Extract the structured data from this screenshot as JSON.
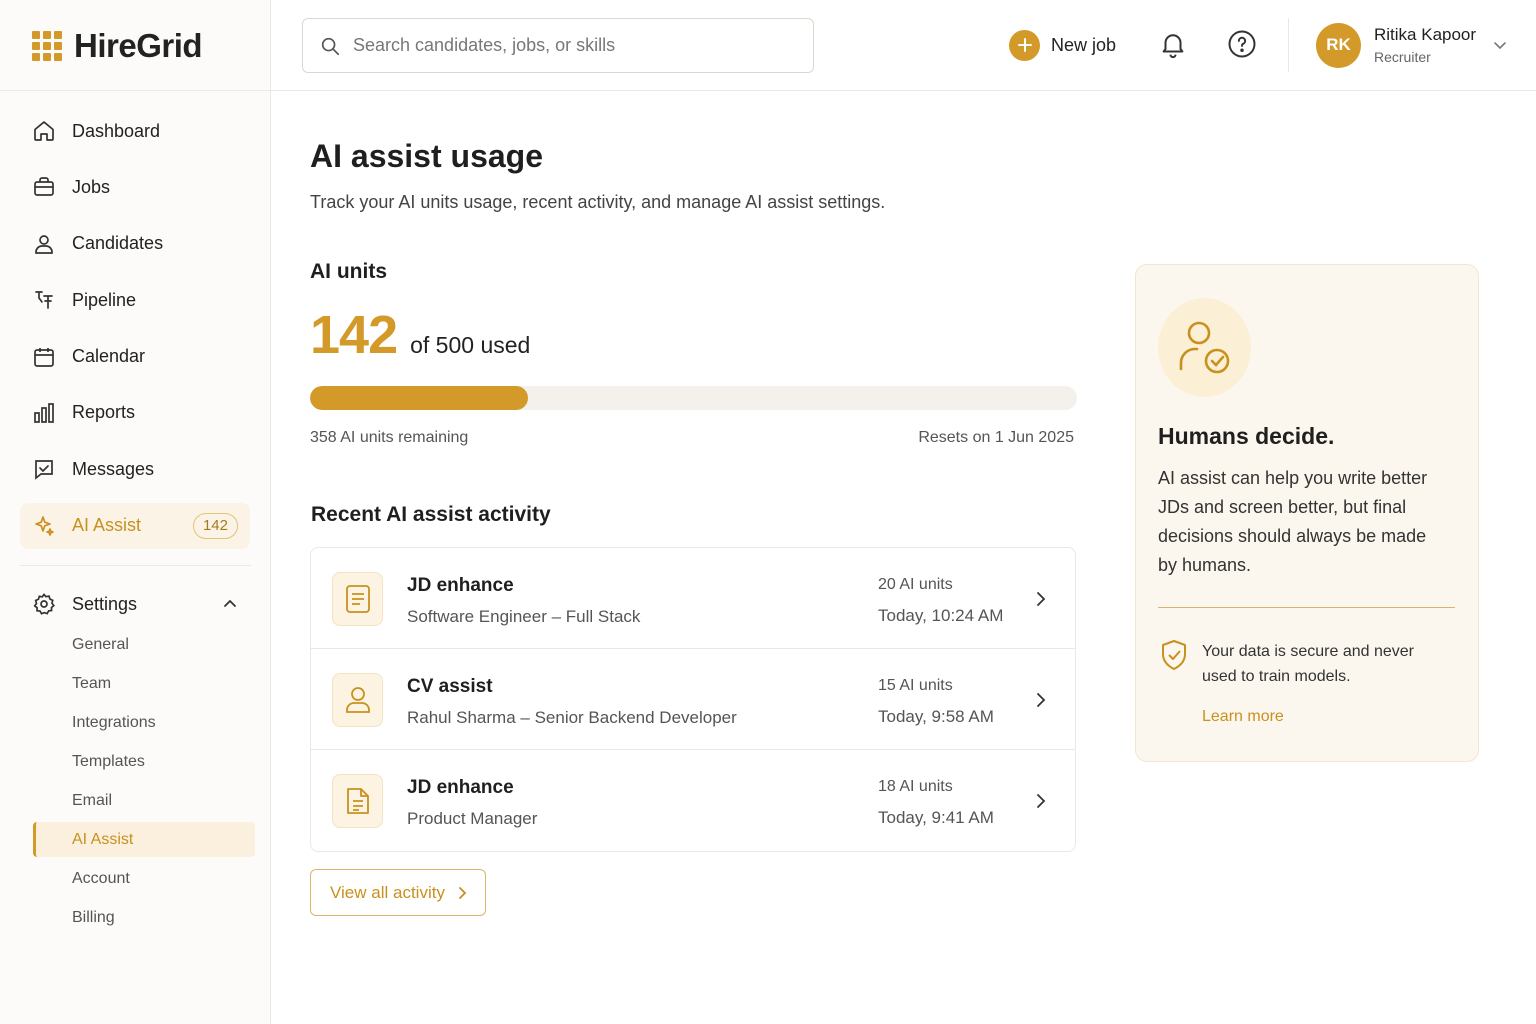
{
  "app": {
    "name": "HireGrid"
  },
  "sidebar": {
    "items": [
      {
        "label": "Dashboard",
        "icon": "home-icon"
      },
      {
        "label": "Jobs",
        "icon": "briefcase-icon"
      },
      {
        "label": "Candidates",
        "icon": "user-icon"
      },
      {
        "label": "Pipeline",
        "icon": "pipeline-icon"
      },
      {
        "label": "Calendar",
        "icon": "calendar-icon"
      },
      {
        "label": "Reports",
        "icon": "bar-chart-icon"
      },
      {
        "label": "Messages",
        "icon": "message-icon"
      },
      {
        "label": "AI Assist",
        "icon": "sparkle-icon",
        "badge": "142",
        "active": true
      }
    ],
    "settings": {
      "label": "Settings",
      "expanded": true,
      "items": [
        "General",
        "Team",
        "Integrations",
        "Templates",
        "Email",
        "AI Assist",
        "Account",
        "Billing"
      ],
      "active": "AI Assist"
    }
  },
  "header": {
    "search_placeholder": "Search candidates, jobs, or skills",
    "new_job_label": "New job",
    "user": {
      "initials": "RK",
      "name": "Ritika Kapoor",
      "role": "Recruiter"
    }
  },
  "main": {
    "title": "AI assist usage",
    "subtitle": "Track your AI units usage, recent activity, and manage AI assist settings.",
    "units": {
      "section_title": "AI units",
      "used": "142",
      "of_label": "of 500 used",
      "used_fraction": 0.284,
      "remaining_label": "358 AI units remaining",
      "reset_label": "Resets on 1 Jun 2025"
    },
    "activity": {
      "section_title": "Recent AI assist activity",
      "rows": [
        {
          "title": "JD enhance",
          "desc": "Software Engineer – Full Stack",
          "units": "20 AI units",
          "time": "Today, 10:24 AM",
          "icon": "document-icon"
        },
        {
          "title": "CV assist",
          "desc": "Rahul Sharma – Senior Backend Developer",
          "units": "15 AI units",
          "time": "Today, 9:58 AM",
          "icon": "user-icon"
        },
        {
          "title": "JD enhance",
          "desc": "Product Manager",
          "units": "18 AI units",
          "time": "Today, 9:41 AM",
          "icon": "document-icon"
        }
      ],
      "view_all_label": "View all activity"
    }
  },
  "info_card": {
    "title": "Humans decide.",
    "text": "AI assist can help you write better JDs and screen better, but final decisions should always be made by humans.",
    "secure_text": "Your data is secure and never used to train models.",
    "link_label": "Learn more"
  },
  "colors": {
    "accent": "#d39a2a",
    "accent_light": "#fbf4e6",
    "card_bg": "#fcf7ee",
    "border": "#ece8e1"
  }
}
